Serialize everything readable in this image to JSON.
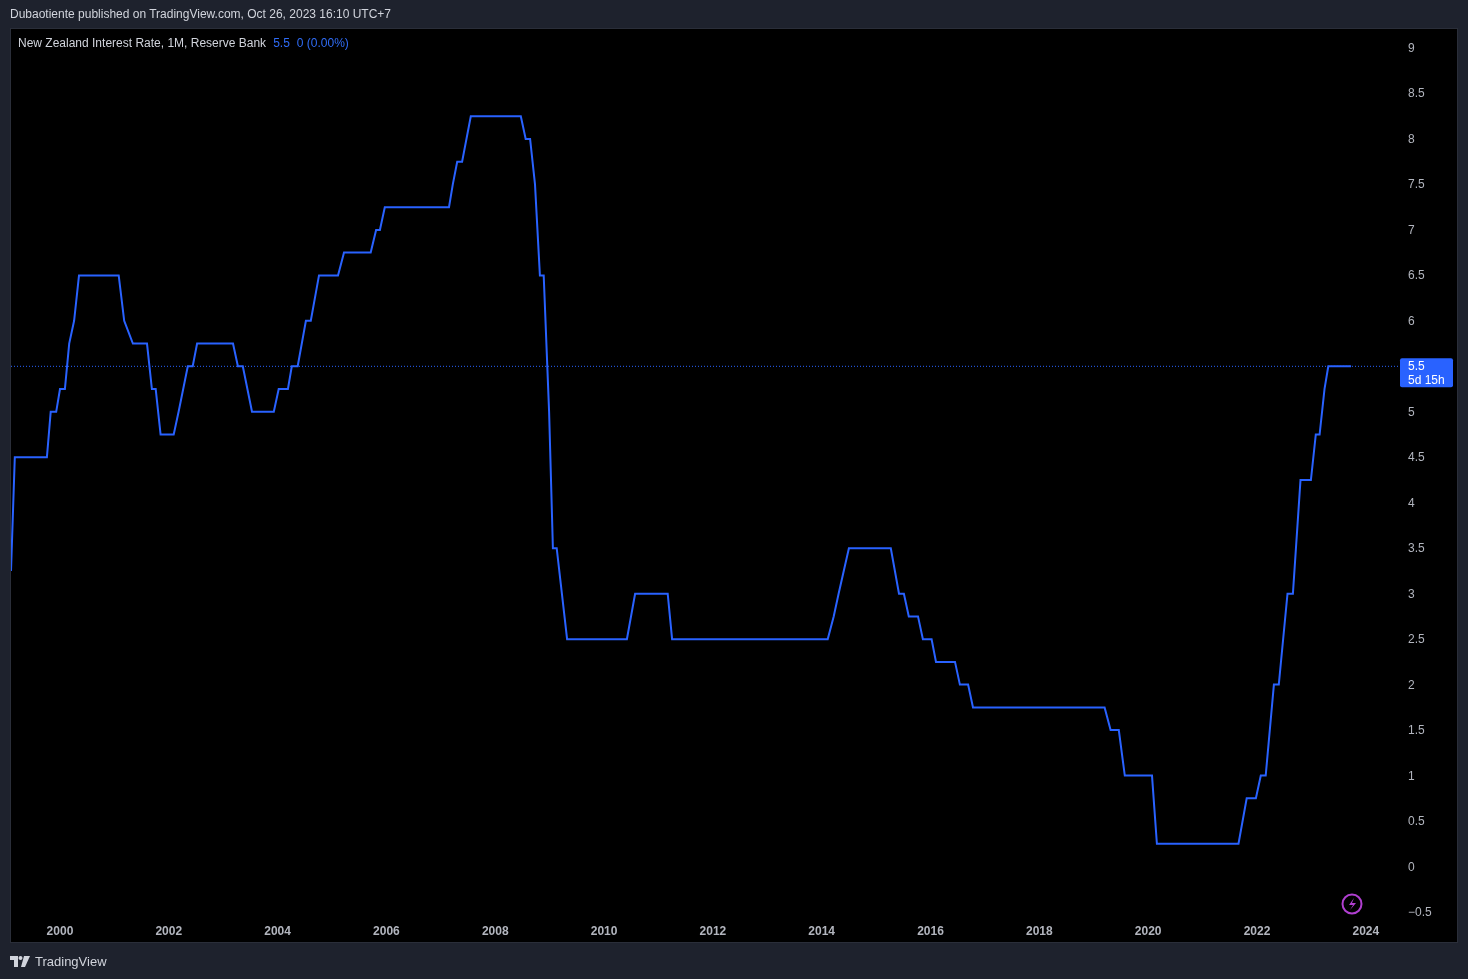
{
  "header": {
    "text": "Dubaotiente published on TradingView.com, Oct 26, 2023 16:10 UTC+7"
  },
  "legend": {
    "title": "New Zealand Interest Rate, 1M, Reserve Bank",
    "value": "5.5",
    "change": "0 (0.00%)"
  },
  "chart": {
    "chart_data": {
      "type": "line",
      "x": [
        1999.1,
        1999.17,
        1999.76,
        1999.83,
        1999.93,
        2000.0,
        2000.09,
        2000.17,
        2000.26,
        2000.35,
        2001.08,
        2001.18,
        2001.34,
        2001.6,
        2001.69,
        2001.76,
        2001.85,
        2002.09,
        2002.18,
        2002.35,
        2002.44,
        2002.52,
        2003.18,
        2003.27,
        2003.36,
        2003.53,
        2003.93,
        2004.02,
        2004.19,
        2004.26,
        2004.37,
        2004.52,
        2004.61,
        2004.76,
        2005.11,
        2005.22,
        2005.71,
        2005.81,
        2005.88,
        2005.97,
        2007.15,
        2007.22,
        2007.3,
        2007.39,
        2007.55,
        2008.47,
        2008.56,
        2008.64,
        2008.73,
        2008.82,
        2008.89,
        2008.99,
        2009.06,
        2009.13,
        2009.32,
        2010.42,
        2010.57,
        2011.17,
        2011.25,
        2014.11,
        2014.22,
        2014.31,
        2014.5,
        2015.27,
        2015.42,
        2015.51,
        2015.6,
        2015.77,
        2015.86,
        2016.02,
        2016.1,
        2016.45,
        2016.54,
        2016.69,
        2016.78,
        2019.2,
        2019.31,
        2019.46,
        2019.57,
        2020.07,
        2020.16,
        2021.66,
        2021.81,
        2021.98,
        2022.07,
        2022.16,
        2022.31,
        2022.4,
        2022.56,
        2022.66,
        2022.8,
        2022.99,
        2023.08,
        2023.15,
        2023.24,
        2023.31,
        2023.73
      ],
      "series": [
        {
          "color": "#2962ff",
          "values": [
            3.25,
            4.5,
            4.5,
            5.0,
            5.0,
            5.25,
            5.25,
            5.75,
            6.0,
            6.5,
            6.5,
            6.0,
            5.75,
            5.75,
            5.25,
            5.25,
            4.75,
            4.75,
            5.0,
            5.5,
            5.5,
            5.75,
            5.75,
            5.5,
            5.5,
            5.0,
            5.0,
            5.25,
            5.25,
            5.5,
            5.5,
            6.0,
            6.0,
            6.5,
            6.5,
            6.75,
            6.75,
            7.0,
            7.0,
            7.25,
            7.25,
            7.5,
            7.75,
            7.75,
            8.25,
            8.25,
            8.0,
            8.0,
            7.5,
            6.5,
            6.5,
            5.0,
            3.5,
            3.5,
            2.5,
            2.5,
            3.0,
            3.0,
            2.5,
            2.5,
            2.75,
            3.0,
            3.5,
            3.5,
            3.0,
            3.0,
            2.75,
            2.75,
            2.5,
            2.5,
            2.25,
            2.25,
            2.0,
            2.0,
            1.75,
            1.75,
            1.5,
            1.5,
            1.0,
            1.0,
            0.25,
            0.25,
            0.75,
            0.75,
            1.0,
            1.0,
            2.0,
            2.0,
            3.0,
            3.0,
            4.25,
            4.25,
            4.75,
            4.75,
            5.25,
            5.5,
            5.5
          ]
        }
      ],
      "xlim": [
        1999.1,
        2024.61
      ],
      "ylim": [
        -0.5,
        9
      ],
      "ref_lines": [
        {
          "axis": "y",
          "value": 5.5,
          "color": "#2962ff",
          "label": "5.5"
        }
      ],
      "xticks": [
        2000,
        2002,
        2004,
        2006,
        2008,
        2010,
        2012,
        2014,
        2016,
        2018,
        2020,
        2022,
        2024
      ],
      "yticks": [
        {
          "value": -0.5,
          "label": "−0.5"
        },
        0,
        0.5,
        1,
        1.5,
        2,
        2.5,
        3,
        3.5,
        4,
        4.5,
        5,
        5.5,
        6,
        6.5,
        7,
        7.5,
        8,
        8.5,
        9
      ]
    },
    "price_label": {
      "countdown": "5d 15h"
    }
  },
  "footer": {
    "brand": "TradingView"
  }
}
